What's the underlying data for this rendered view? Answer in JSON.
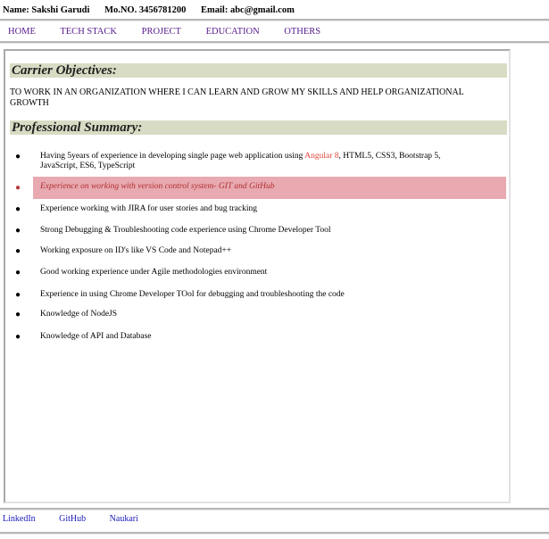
{
  "header": {
    "name": "Name: Sakshi Garudi",
    "mobile": "Mo.NO. 3456781200",
    "email": "Email: abc@gmail.com"
  },
  "nav": {
    "items": [
      "HOME",
      "TECH STACK",
      "PROJECT",
      "EDUCATION",
      "OTHERS"
    ]
  },
  "objectives": {
    "title": "Carrier Objectives:",
    "text": "TO WORK IN AN ORGANIZATION WHERE I CAN LEARN AND GROW MY SKILLS AND HELP ORGANIZATIONAL GROWTH"
  },
  "summary": {
    "title": "Professional Summary:",
    "item1_pre": "Having 5years of experience in developing single page web application using ",
    "item1_accent": "Angular 8",
    "item1_post": ", HTML5, CSS3, Bootstrap 5, JavaScript, ES6, TypeScript",
    "item2": "Experience on working with version control system- GIT and GitHub",
    "item3": "Experience working with JIRA for user stories and bug tracking",
    "item4": "Strong Debugging & Troubleshooting code experience using Chrome Developer Tool",
    "item5": "Working exposure on ID's like VS Code and Notepad++",
    "item6": "Good working experience under Agile methodologies environment",
    "item7": "Experience in using Chrome Developer TOol for debugging and troubleshooting the code",
    "item8": "Knowledge of NodeJS",
    "item9": "Knowledge of API and Database"
  },
  "footer": {
    "links": [
      "LinkedIn",
      "GitHub",
      "Naukari"
    ]
  },
  "colors": {
    "section_band": "#d8dcc4",
    "highlight_row": "#e8a9b0",
    "accent_text": "#e2453c",
    "nav_link": "#551a8b",
    "footer_link": "#1a1ab8"
  }
}
